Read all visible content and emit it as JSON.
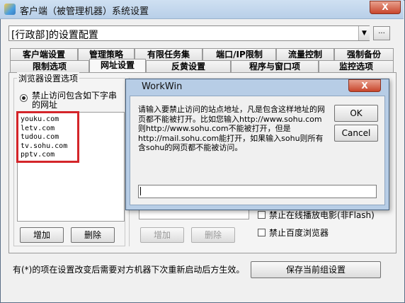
{
  "window": {
    "title": "客户端（被管理机器）系统设置",
    "close": "X"
  },
  "config": {
    "selected": "[行政部]的设置配置",
    "more": "..."
  },
  "tabs_row1": [
    "客户端设置",
    "管理策略",
    "有限任务集",
    "端口/IP限制",
    "流量控制",
    "强制备份"
  ],
  "tabs_row2": [
    "限制选项",
    "网址设置",
    "反黄设置",
    "程序与窗口项",
    "监控选项"
  ],
  "group": {
    "legend": "浏览器设置选项",
    "radio_label": "禁止访问包含如下字串的网址",
    "urls": [
      "youku.com",
      "letv.com",
      "tudou.com",
      "tv.sohu.com",
      "pptv.com"
    ],
    "add": "增加",
    "delete": "删除"
  },
  "middle": {
    "add": "增加",
    "delete": "删除"
  },
  "options": {
    "online_movie": "禁止在线播放电影(非Flash)",
    "baidu_browser": "禁止百度浏览器"
  },
  "footer": {
    "note": "有(*)的项在设置改变后需要对方机器下次重新启动后方生效。",
    "save": "保存当前组设置"
  },
  "dialog": {
    "title": "WorkWin",
    "close": "X",
    "prompt": "请输入要禁止访问的站点地址，凡是包含这样地址的网页都不能被打开。比如您输入http://www.sohu.com则http://www.sohu.com不能被打开，但是http://mail.sohu.com能打开，如果输入sohu则所有含sohu的网页都不能被访问。",
    "ok": "OK",
    "cancel": "Cancel",
    "input_value": ""
  },
  "colors": {
    "highlight": "#d4252a",
    "titlebar": "#b8cfe8"
  }
}
